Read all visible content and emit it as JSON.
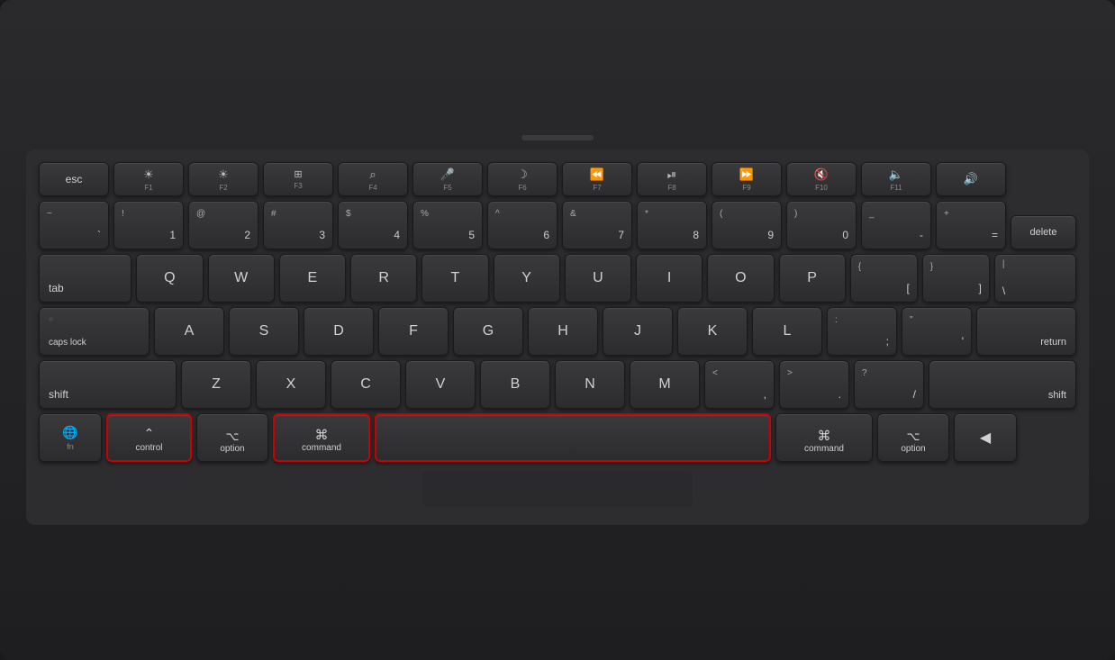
{
  "keyboard": {
    "rows": {
      "fn_row": [
        "esc",
        "F1",
        "F2",
        "F3",
        "F4",
        "F5",
        "F6",
        "F7",
        "F8",
        "F9",
        "F10",
        "F11"
      ],
      "number_row": [
        "~`",
        "!1",
        "@2",
        "#3",
        "$4",
        "%5",
        "^6",
        "&7",
        "*8",
        "(9",
        ")0",
        "-_"
      ],
      "top_alpha": [
        "tab",
        "Q",
        "W",
        "E",
        "R",
        "T",
        "Y",
        "U",
        "I",
        "O",
        "P",
        "{["
      ],
      "mid_alpha": [
        "caps lock",
        "A",
        "S",
        "D",
        "F",
        "G",
        "H",
        "J",
        "K",
        "L",
        ";:",
        "'\""
      ],
      "bot_alpha": [
        "shift",
        "Z",
        "X",
        "C",
        "V",
        "B",
        "N",
        "M",
        "<,",
        ">.",
        "?/"
      ],
      "bottom_row": [
        "fn/globe",
        "control",
        "option",
        "command",
        "space",
        "command",
        "option",
        "arrow"
      ]
    },
    "highlighted": [
      "control",
      "command-left",
      "space"
    ],
    "labels": {
      "esc": "esc",
      "tab": "tab",
      "caps_lock": "caps lock",
      "shift": "shift",
      "fn": "fn",
      "globe": "🌐",
      "control": "control",
      "option": "option",
      "command": "command",
      "return": "return"
    }
  }
}
